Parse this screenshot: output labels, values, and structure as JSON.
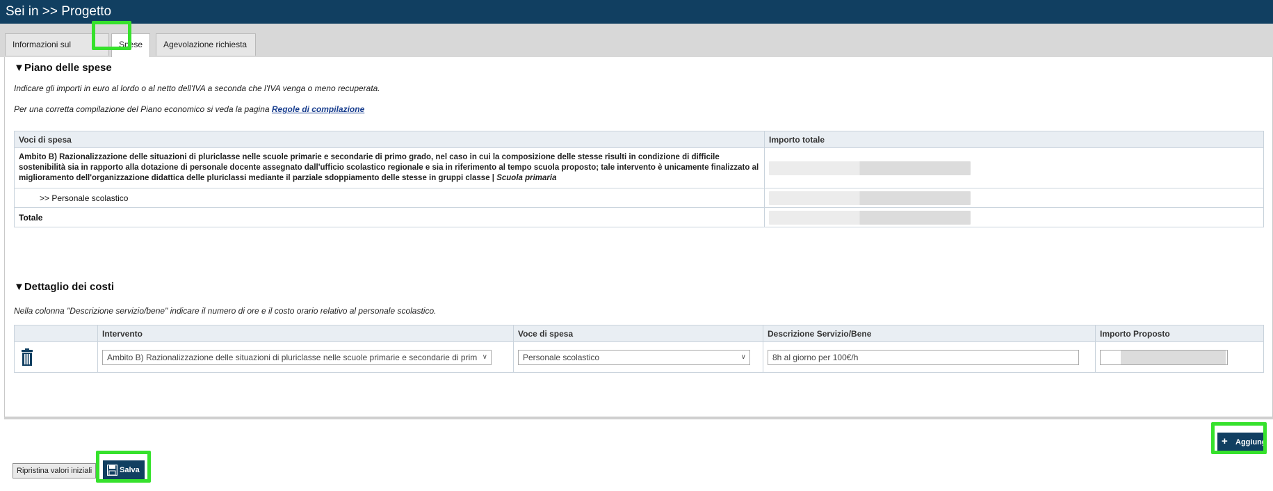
{
  "title": "Sei in >> Progetto",
  "tabs": [
    {
      "label": "Informazioni sul progetto"
    },
    {
      "label": "Spese"
    },
    {
      "label": "Agevolazione richiesta"
    }
  ],
  "piano": {
    "title": "▼Piano delle spese",
    "note1": "Indicare gli importi in euro al lordo o al netto dell'IVA a seconda che l'IVA venga o meno recuperata.",
    "note2_prefix": "Per una corretta compilazione del Piano economico si veda la pagina ",
    "note2_link": "Regole di compilazione",
    "headers": {
      "voci": "Voci di spesa",
      "importo": "Importo totale"
    },
    "row_ambito": "Ambito B) Razionalizzazione delle situazioni di pluriclasse nelle scuole primarie e secondarie di primo grado, nel caso in cui la composizione delle stesse risulti in condizione di difficile sostenibilità sia in rapporto alla dotazione di personale docente assegnato dall'ufficio scolastico regionale e sia in riferimento al tempo scuola proposto; tale intervento è unicamente finalizzato al miglioramento dell'organizzazione didattica delle pluriclassi mediante il parziale sdoppiamento delle stesse in gruppi classe | ",
    "row_ambito_italic": "Scuola primaria",
    "row_personale": ">> Personale scolastico",
    "row_totale": "Totale"
  },
  "dettaglio": {
    "title": "▼Dettaglio dei costi",
    "note": "Nella colonna \"Descrizione servizio/bene\" indicare il numero di ore e il costo orario relativo al personale scolastico.",
    "headers": {
      "intervento": "Intervento",
      "voce": "Voce di spesa",
      "descrizione": "Descrizione Servizio/Bene",
      "importo": "Importo Proposto"
    },
    "row": {
      "intervento": "Ambito B) Razionalizzazione delle situazioni di pluriclasse nelle scuole primarie e secondarie di prim",
      "voce": "Personale scolastico",
      "descrizione": "8h al giorno per 100€/h"
    }
  },
  "buttons": {
    "ripristina": "Ripristina valori iniziali",
    "salva": "Salva",
    "aggiungi": "Aggiungi"
  },
  "icons": {
    "trash": "trash-icon",
    "save": "floppy-disk-icon",
    "plus": "plus-icon",
    "chevron": "chevron-down-icon"
  },
  "colors": {
    "header_bar": "#113f61",
    "highlight": "#36e12c"
  }
}
